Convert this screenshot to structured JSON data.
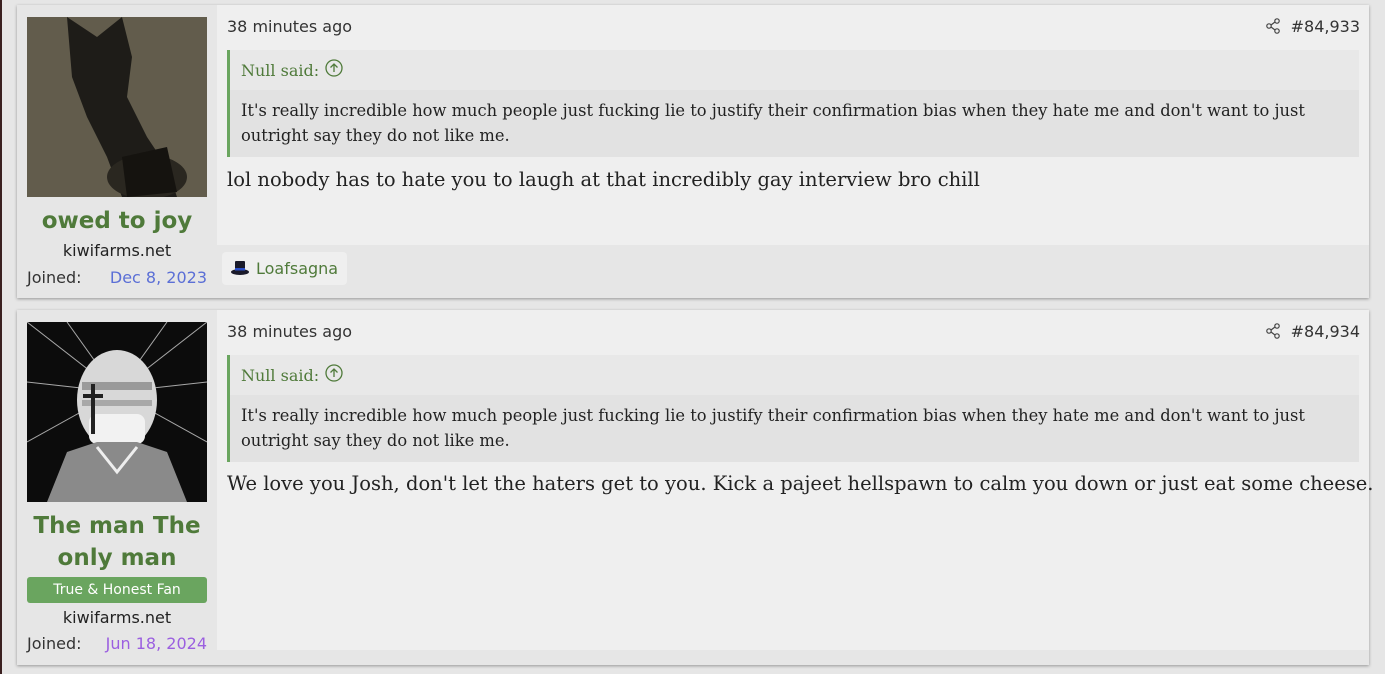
{
  "posts": [
    {
      "username": "owed to joy",
      "site": "kiwifarms.net",
      "joined_label": "Joined:",
      "joined_date": "Dec 8, 2023",
      "joined_color": "#5b6fd6",
      "time": "38 minutes ago",
      "post_number": "#84,933",
      "quote_author": "Null said:",
      "quote_text": "It's really incredible how much people just fucking lie to justify their confirmation bias when they hate me and don't want to just outright say they do not like me.",
      "message": "lol nobody has to hate you to laugh at that incredibly gay interview bro chill",
      "reaction_user": "Loafsagna"
    },
    {
      "username": "The man The only man",
      "banner": "True & Honest Fan",
      "site": "kiwifarms.net",
      "joined_label": "Joined:",
      "joined_date": "Jun 18, 2024",
      "joined_color": "#9b5fe0",
      "time": "38 minutes ago",
      "post_number": "#84,934",
      "quote_author": "Null said:",
      "quote_text": "It's really incredible how much people just fucking lie to justify their confirmation bias when they hate me and don't want to just outright say they do not like me.",
      "message": "We love you Josh, don't let the haters get to you. Kick a pajeet hellspawn to calm you down or just eat some cheese."
    }
  ],
  "icons": {
    "share": "share-icon",
    "quote_jump": "arrow-up-circle-icon",
    "reaction": "top-hat-icon"
  },
  "colors": {
    "username": "#4f7a3a",
    "accent_green": "#6aa55f",
    "post_bg": "#efefef",
    "user_panel_bg": "#e6e6e6"
  }
}
